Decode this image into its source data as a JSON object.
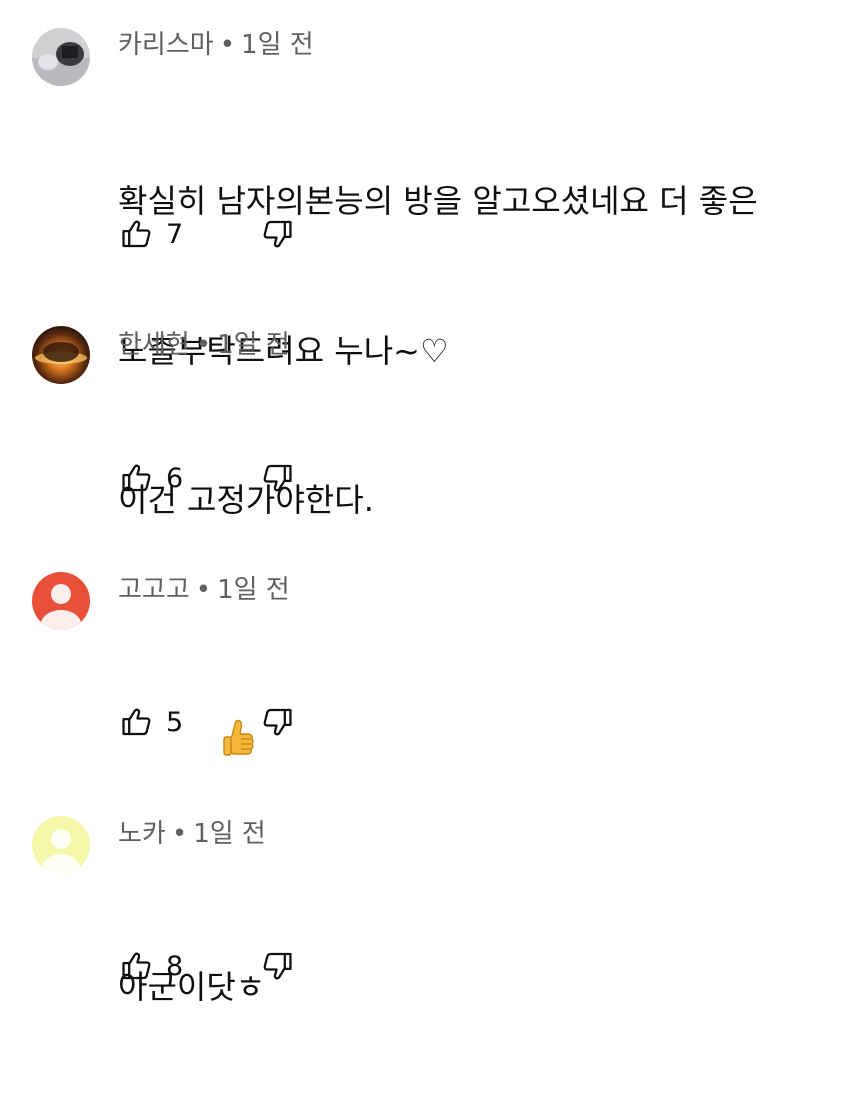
{
  "comments": [
    {
      "author": "카리스마",
      "separator": "•",
      "time": "1일 전",
      "text_line1": "확실히 남자의본능의 방을 알고오셨네요 더 좋은",
      "text_line2": "노출부탁드려요 누나~♡",
      "likes": "7",
      "avatar": "photo-dark-figure"
    },
    {
      "author": "한세현",
      "separator": "•",
      "time": "1일 전",
      "text_line1": "이건 고정가야한다.",
      "likes": "6",
      "avatar": "photo-eclipse-glow"
    },
    {
      "author": "고고고",
      "separator": "•",
      "time": "1일 전",
      "text_line1": "",
      "emoji": "thumbs-up-emoji",
      "likes": "5",
      "avatar": "default-user-orange",
      "avatar_color": "#e8503a"
    },
    {
      "author": "노카",
      "separator": "•",
      "time": "1일 전",
      "text_line1": "아군이닷ㅎ",
      "likes": "8",
      "avatar": "default-user-yellow",
      "avatar_color": "#f4f7a8"
    }
  ],
  "icons": {
    "like": "thumbs-up-outline-icon",
    "dislike": "thumbs-down-outline-icon"
  }
}
